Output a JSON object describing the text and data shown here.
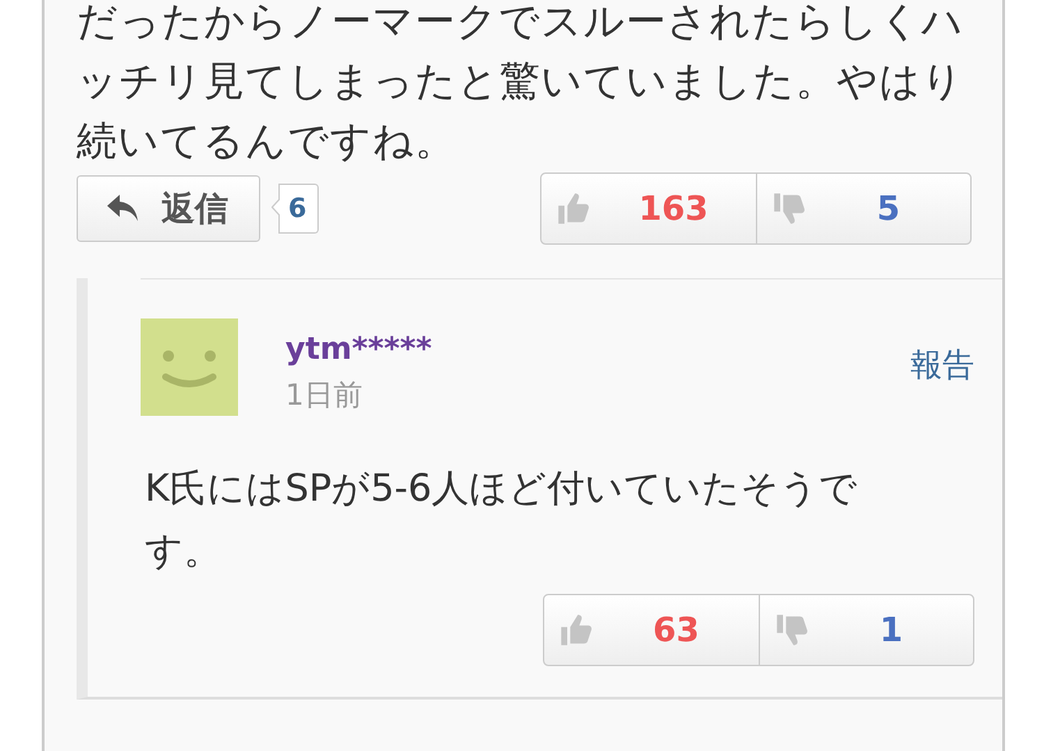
{
  "comment": {
    "lines": [
      "だったからノーマークでスルーされたらしくハ",
      "ッチリ見てしまったと驚いていました。やはり",
      "続いてるんですね。"
    ],
    "reply_button": "返信",
    "reply_count": "6",
    "likes": "163",
    "dislikes": "5"
  },
  "reply": {
    "username": "ytm*****",
    "time": "1日前",
    "report": "報告",
    "lines": [
      "K氏にはSPが5-6人ほど付いていたそうで",
      "す。"
    ],
    "likes": "63",
    "dislikes": "1"
  }
}
